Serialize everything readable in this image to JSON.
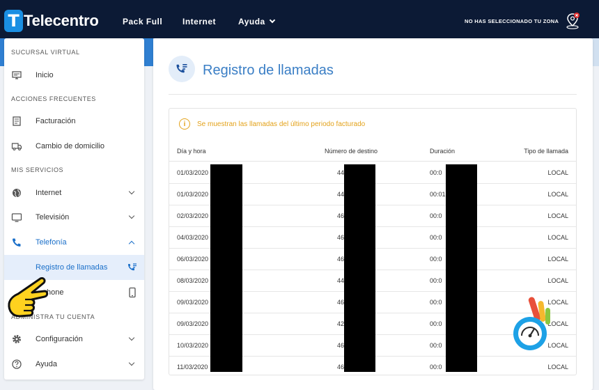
{
  "header": {
    "brand": "Telecentro",
    "nav": [
      {
        "label": "Pack Full"
      },
      {
        "label": "Internet"
      },
      {
        "label": "Ayuda"
      }
    ],
    "zone_text": "NO HAS SELECCIONADO TU ZONA"
  },
  "sidebar": {
    "sections": [
      {
        "title": "SUCURSAL VIRTUAL"
      },
      {
        "title": "ACCIONES FRECUENTES"
      },
      {
        "title": "MIS SERVICIOS"
      },
      {
        "title": "ADMINISTRA TU CUENTA"
      }
    ],
    "items": [
      {
        "label": "Inicio"
      },
      {
        "label": "Facturación"
      },
      {
        "label": "Cambio de domicilio"
      },
      {
        "label": "Internet"
      },
      {
        "label": "Televisión"
      },
      {
        "label": "Telefonía"
      },
      {
        "label": "Registro de llamadas"
      },
      {
        "label": "Mi Phone",
        "visible_label": "hone"
      },
      {
        "label": "Configuración"
      },
      {
        "label": "Ayuda"
      }
    ]
  },
  "main": {
    "title": "Registro de llamadas",
    "notice": "Se muestran las llamadas del último periodo facturado",
    "columns": [
      "Día y hora",
      "Número de destino",
      "Duración",
      "Tipo de llamada"
    ],
    "rows": [
      {
        "date": "01/03/2020",
        "number": "44",
        "duration": "00:0",
        "type": "LOCAL"
      },
      {
        "date": "01/03/2020",
        "number": "44",
        "duration": "00:01",
        "type": "LOCAL"
      },
      {
        "date": "02/03/2020",
        "number": "46",
        "duration": "00:0",
        "type": "LOCAL"
      },
      {
        "date": "04/03/2020",
        "number": "46",
        "duration": "00:0",
        "type": "LOCAL"
      },
      {
        "date": "06/03/2020",
        "number": "46",
        "duration": "00:0",
        "type": "LOCAL"
      },
      {
        "date": "08/03/2020",
        "number": "44",
        "duration": "00:0",
        "type": "LOCAL"
      },
      {
        "date": "09/03/2020",
        "number": "46",
        "duration": "00:0",
        "type": "LOCAL"
      },
      {
        "date": "09/03/2020",
        "number": "42",
        "duration": "00:0",
        "type": "LOCAL"
      },
      {
        "date": "10/03/2020",
        "number": "46",
        "duration": "00:0",
        "type": "LOCAL"
      },
      {
        "date": "11/03/2020",
        "number": "46",
        "duration": "00:0",
        "type": "LOCAL"
      }
    ]
  },
  "colors": {
    "navbar": "#0c1a35",
    "accent": "#1a6fc9",
    "title": "#3a7ec5",
    "warning": "#e3a21a"
  },
  "icons": {
    "brand": "telecentro-logo-icon",
    "zone": "location-pin-icon",
    "inicio": "monitor-icon",
    "facturacion": "receipt-icon",
    "domicilio": "truck-icon",
    "internet": "globe-icon",
    "television": "tv-icon",
    "telefonia": "phone-icon",
    "registro": "phone-list-icon",
    "miphone": "smartphone-icon",
    "configuracion": "gear-icon",
    "ayuda": "help-circle-icon"
  }
}
